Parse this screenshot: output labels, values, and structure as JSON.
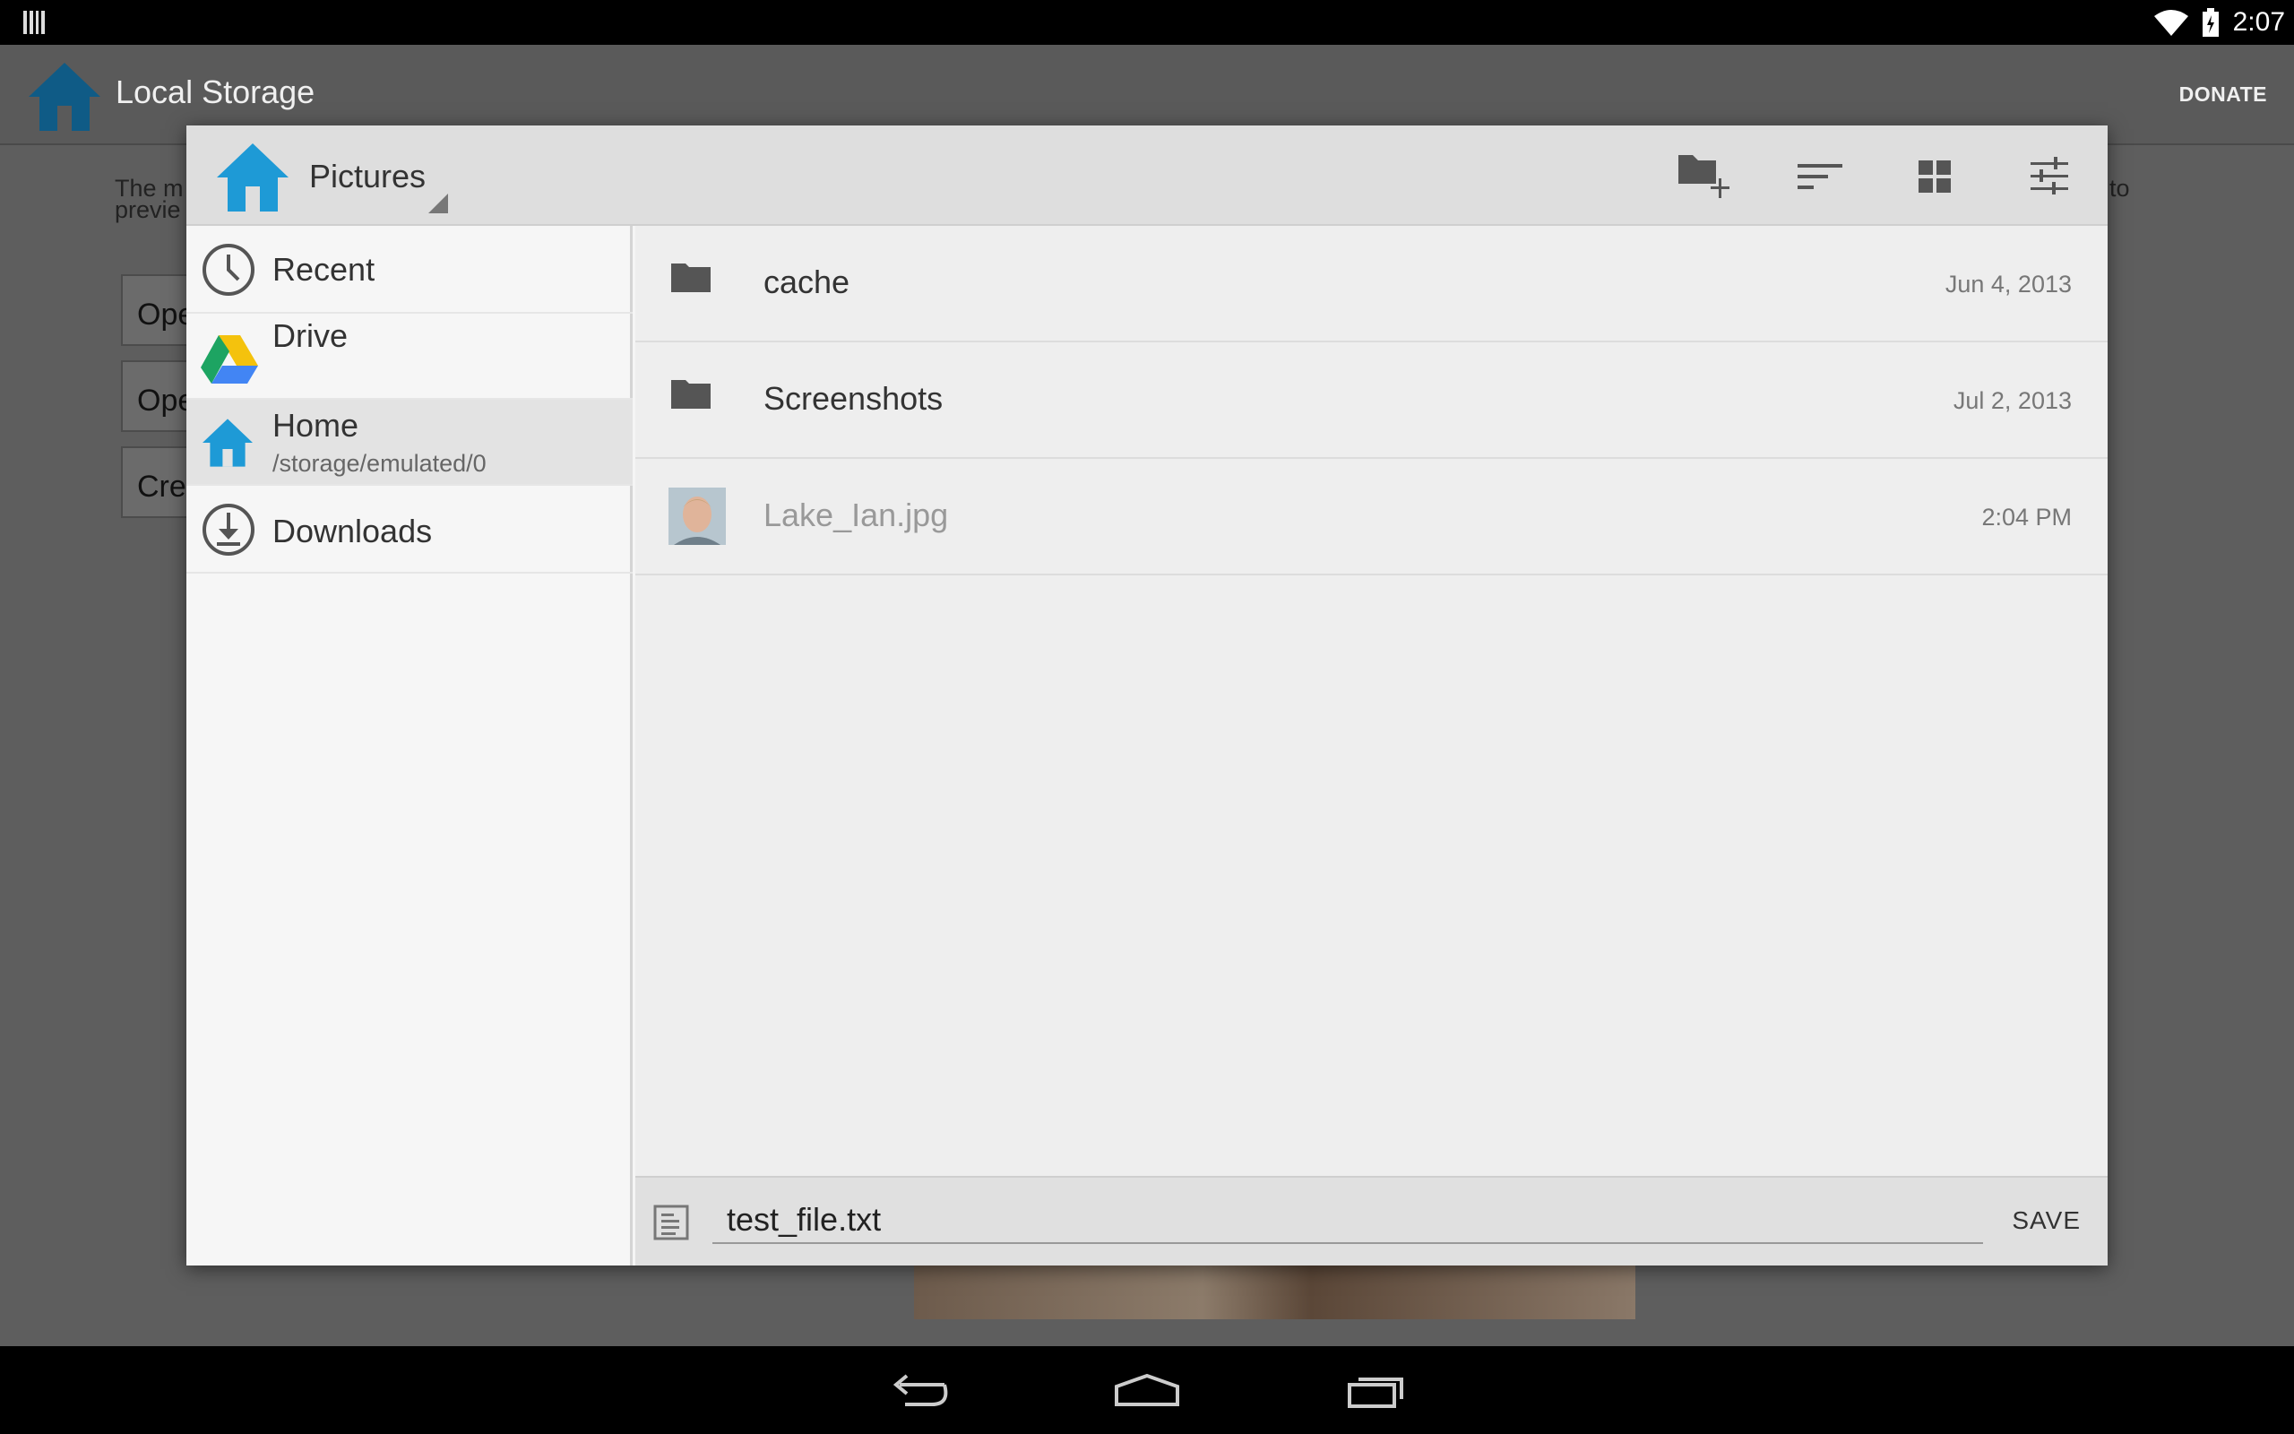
{
  "status_bar": {
    "time": "2:07"
  },
  "background_app": {
    "title": "Local Storage",
    "donate_label": "DONATE",
    "text_line1_left": "The m",
    "text_line1_right": "s to",
    "text_line2_left": "previe",
    "buttons": [
      "Ope",
      "Ope",
      "Cre"
    ]
  },
  "dialog": {
    "location": "Pictures",
    "toolbar": {
      "new_folder_icon": "new-folder-icon",
      "sort_icon": "sort-icon",
      "grid_icon": "grid-view-icon",
      "settings_icon": "settings-sliders-icon"
    },
    "roots": [
      {
        "label": "Recent",
        "icon": "clock-icon"
      },
      {
        "label": "Drive",
        "icon": "drive-icon"
      },
      {
        "label": "Home",
        "sub": "/storage/emulated/0",
        "icon": "home-icon",
        "selected": true
      },
      {
        "label": "Downloads",
        "icon": "download-icon"
      }
    ],
    "files": [
      {
        "name": "cache",
        "date": "Jun 4, 2013",
        "type": "folder"
      },
      {
        "name": "Screenshots",
        "date": "Jul 2, 2013",
        "type": "folder"
      },
      {
        "name": "Lake_Ian.jpg",
        "date": "2:04 PM",
        "type": "image",
        "disabled": true
      }
    ],
    "filename_value": "test_file.txt",
    "save_label": "SAVE"
  },
  "colors": {
    "accent_blue": "#1e9ad6",
    "header_bg": "#dedede"
  }
}
